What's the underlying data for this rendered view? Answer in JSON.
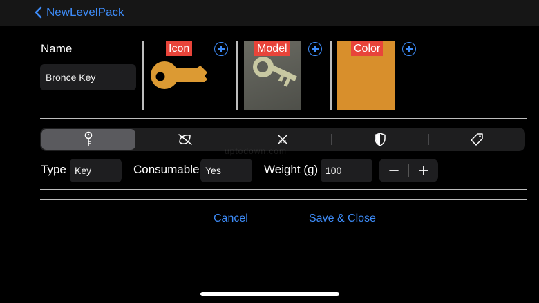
{
  "nav": {
    "back_label": "NewLevelPack"
  },
  "name_section": {
    "label": "Name",
    "value": "Bronce Key"
  },
  "assets": {
    "icon_label": "Icon",
    "model_label": "Model",
    "color_label": "Color",
    "color_swatch": "#d88f2c",
    "key_color": "#dc9a33"
  },
  "tabs": [
    {
      "icon": "key-icon",
      "selected": true
    },
    {
      "icon": "leaf-slash-icon",
      "selected": false
    },
    {
      "icon": "crossed-swords-icon",
      "selected": false
    },
    {
      "icon": "shield-icon",
      "selected": false
    },
    {
      "icon": "tag-icon",
      "selected": false
    }
  ],
  "properties": {
    "type_label": "Type",
    "type_value": "Key",
    "consumable_label": "Consumable",
    "consumable_value": "Yes",
    "weight_label": "Weight (g)",
    "weight_value": "100"
  },
  "actions": {
    "cancel_label": "Cancel",
    "save_label": "Save & Close"
  },
  "watermark": "uptodown.com"
}
